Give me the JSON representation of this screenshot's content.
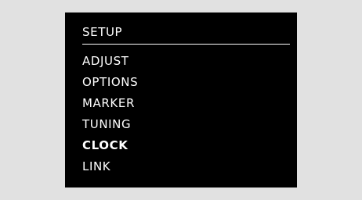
{
  "menu": {
    "title": "SETUP",
    "selected_index": 4,
    "items": [
      {
        "label": "ADJUST"
      },
      {
        "label": "OPTIONS"
      },
      {
        "label": "MARKER"
      },
      {
        "label": "TUNING"
      },
      {
        "label": "CLOCK"
      },
      {
        "label": "LINK"
      }
    ]
  },
  "colors": {
    "background": "#e1e1e1",
    "screen": "#000000",
    "text": "#ffffff"
  }
}
